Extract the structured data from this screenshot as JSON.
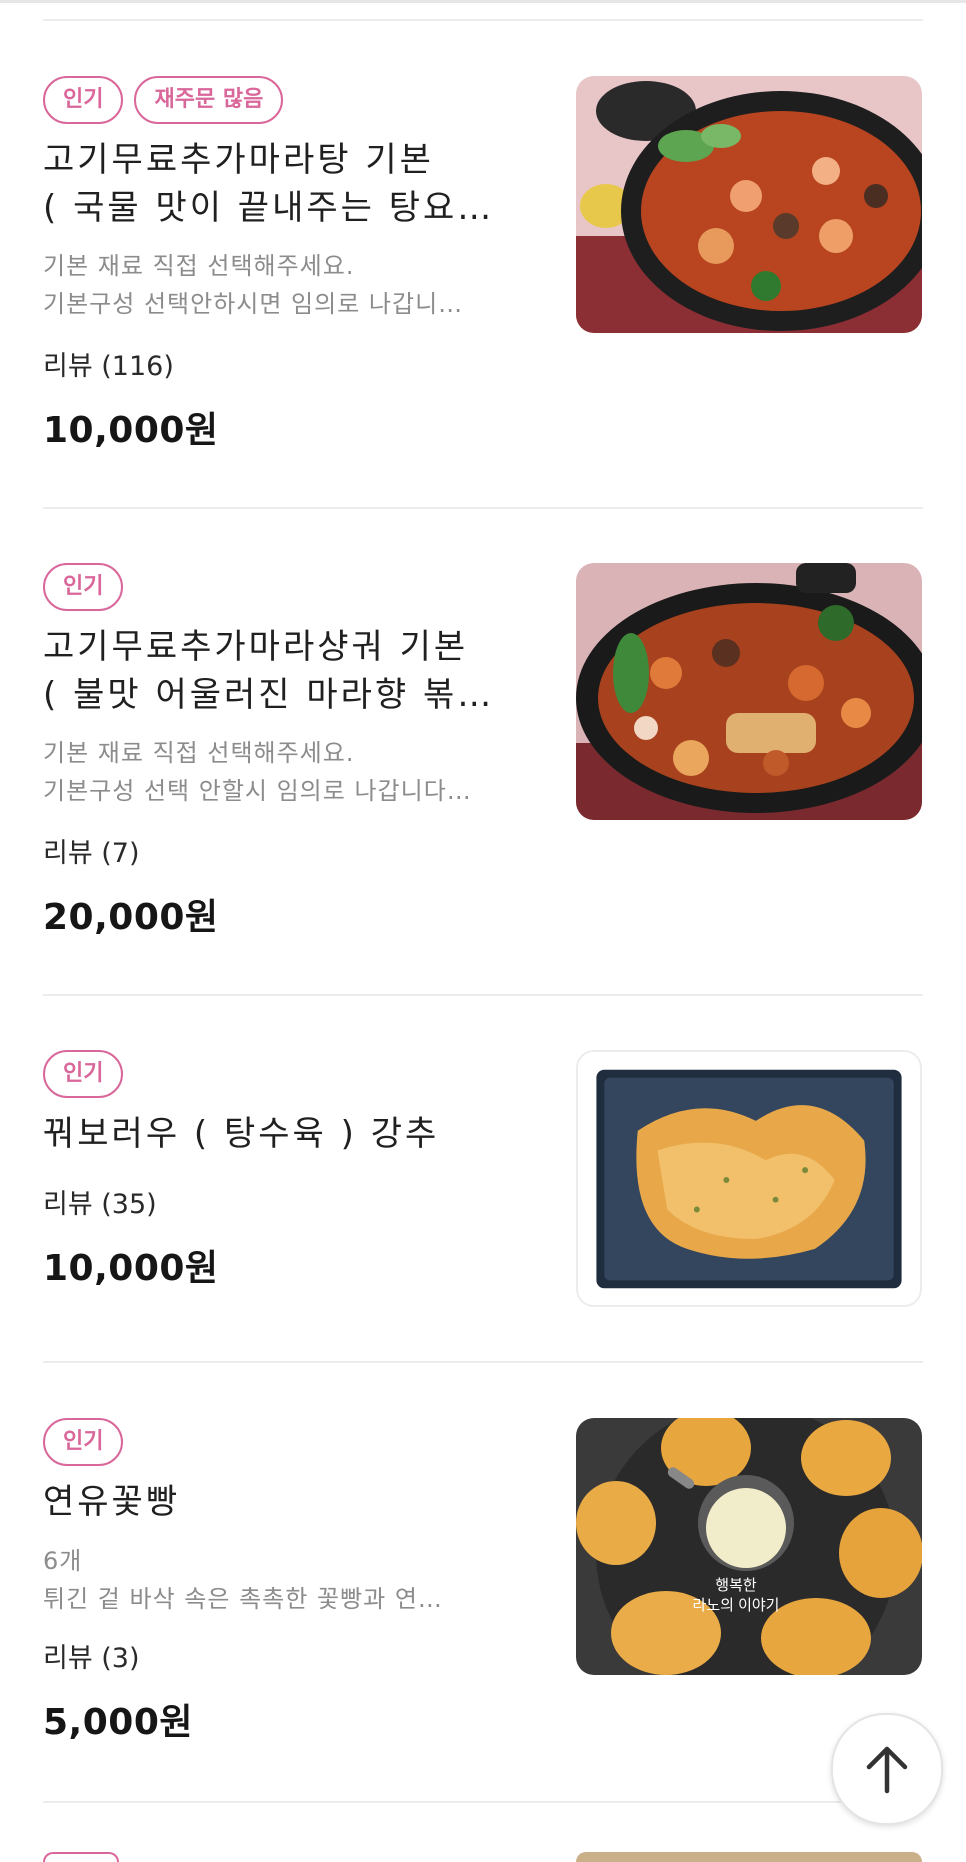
{
  "menu_items": [
    {
      "badges": [
        "인기",
        "재주문 많음"
      ],
      "title_lines": [
        "고기무료추가마라탕 기본",
        "( 국물 맛이 끝내주는 탕요…"
      ],
      "desc_lines": [
        "기본 재료 직접 선택해주세요.",
        "기본구성 선택안하시면 임의로 나갑니…"
      ],
      "reviews": "리뷰 (116)",
      "price": "10,000원",
      "image": "malatang-soup-photo"
    },
    {
      "badges": [
        "인기"
      ],
      "title_lines": [
        "고기무료추가마라샹궈 기본",
        "( 불맛 어울러진 마라향 볶…"
      ],
      "desc_lines": [
        "기본 재료 직접 선택해주세요.",
        "기본구성 선택 안할시 임의로 나갑니다…"
      ],
      "reviews": "리뷰 (7)",
      "price": "20,000원",
      "image": "malaxiangguo-photo"
    },
    {
      "badges": [
        "인기"
      ],
      "title_lines": [
        "꿔보러우 ( 탕수육 ) 강추"
      ],
      "desc_lines": [],
      "reviews": "리뷰 (35)",
      "price": "10,000원",
      "image": "guobaorou-photo"
    },
    {
      "badges": [
        "인기"
      ],
      "title_lines": [
        "연유꽃빵"
      ],
      "desc_lines": [
        "6개",
        "튀긴 겉 바삭 속은 촉촉한 꽃빵과 연…"
      ],
      "reviews": "리뷰 (3)",
      "price": "5,000원",
      "image": "fried-flower-bun-photo",
      "image_caption": [
        "행복한",
        "라노의 이야기"
      ]
    }
  ],
  "scroll_top": {
    "icon": "arrow-up-icon"
  },
  "colors": {
    "badge": "#d9679a",
    "divider": "#ececec"
  }
}
